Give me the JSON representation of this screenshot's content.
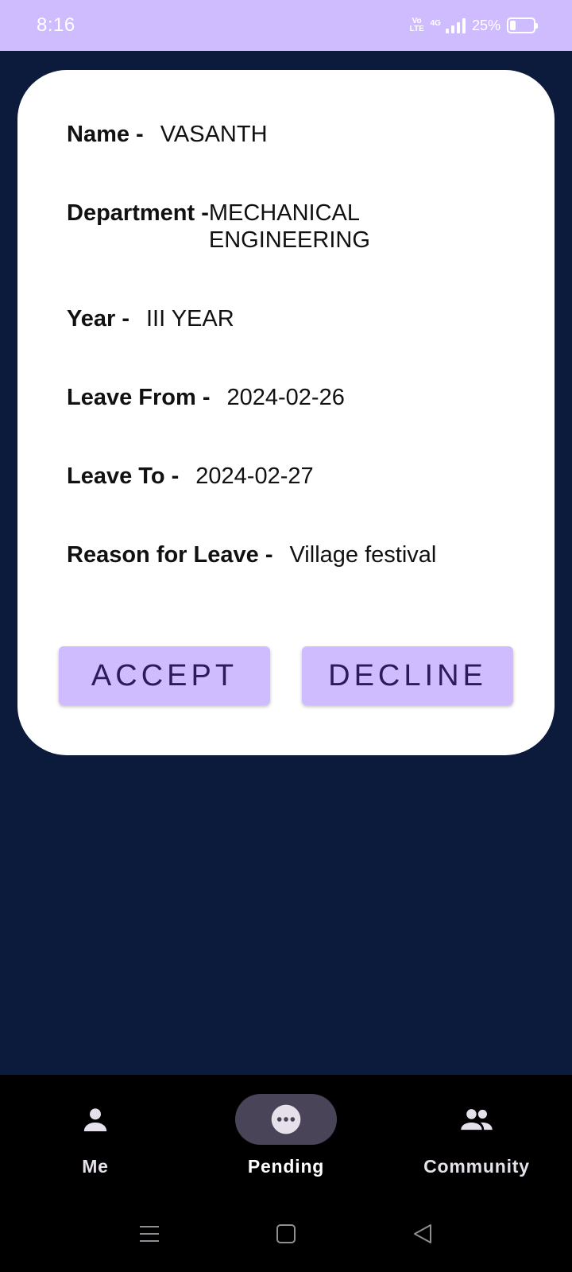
{
  "status_bar": {
    "time": "8:16",
    "volte": "Vo LTE",
    "network": "4G",
    "battery_percent": "25%",
    "battery_level": 0.25
  },
  "leave_request": {
    "name": {
      "label": "Name -",
      "value": "VASANTH"
    },
    "department": {
      "label": "Department -",
      "value": "MECHANICAL ENGINEERING"
    },
    "year": {
      "label": "Year -",
      "value": "III YEAR"
    },
    "leave_from": {
      "label": "Leave From -",
      "value": "2024-02-26"
    },
    "leave_to": {
      "label": "Leave To -",
      "value": "2024-02-27"
    },
    "reason": {
      "label": "Reason for Leave -",
      "value": "Village festival"
    },
    "accept_label": "ACCEPT",
    "decline_label": "DECLINE"
  },
  "bottom_nav": {
    "items": [
      {
        "label": "Me",
        "icon": "person-icon",
        "selected": false
      },
      {
        "label": "Pending",
        "icon": "more-horiz-icon",
        "selected": true
      },
      {
        "label": "Community",
        "icon": "group-icon",
        "selected": false
      }
    ]
  },
  "system_nav": {
    "icons": [
      "menu-icon",
      "home-icon",
      "back-icon"
    ]
  },
  "colors": {
    "background": "#0c1b3b",
    "accent": "#cfbcff",
    "button_text": "#2b1a5c",
    "nav_background": "#000000",
    "nav_indicator": "#4a4458"
  }
}
